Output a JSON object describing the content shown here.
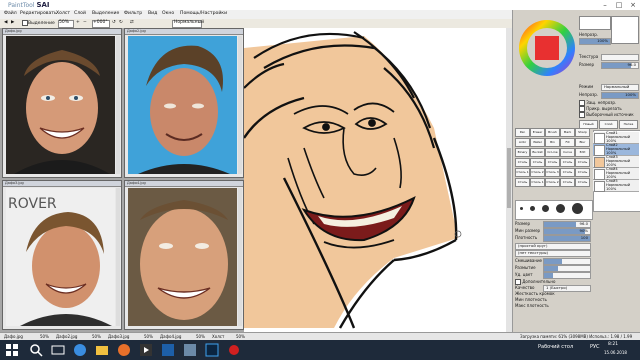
{
  "app": {
    "title_prefix": "PaintTool",
    "title_brand": "SAI"
  },
  "menu": [
    "Файл",
    "Редактировать",
    "Холст",
    "Слой",
    "Выделение",
    "Фильтр",
    "Вид",
    "Окно",
    "Помощь/Настройки"
  ],
  "toolbar": {
    "checkbox_label": "Выделение",
    "zoom": "50%",
    "angle": "+000°",
    "mode_label": "Нормальный"
  },
  "documents": [
    {
      "name": "Дафо.jpg"
    },
    {
      "name": "Дафо2.jpg"
    },
    {
      "name": "Дафо3.jpg"
    },
    {
      "name": "Дафо4.jpg"
    }
  ],
  "right_panel": {
    "color_values": [
      "Непрозр.",
      "100%"
    ],
    "brush_rows": [
      {
        "label": "Текстура",
        "value": ""
      },
      {
        "label": "Размер",
        "value": "96.0"
      }
    ],
    "mode_label": "Режим",
    "mode_value": "Нормальный",
    "opacity_label": "Непрозр.",
    "opacity_value": "100%",
    "checkbox_rows": [
      "Защ. непрозр.",
      "Прикр. вырезать",
      "Выборочный источник"
    ],
    "layer_buttons": [
      "Новый",
      "Слой",
      "Папка"
    ],
    "tools": [
      [
        "Pen",
        "Eraser",
        "Brush",
        "Mark",
        "Sharp"
      ],
      [
        "Airbr",
        "Water",
        "Bin",
        "Fill",
        "Blur"
      ],
      [
        "Binary",
        "Bucket",
        "Cr.Line",
        "Curve",
        "Edit"
      ],
      [
        "Стиль",
        "Стиль",
        "Стиль",
        "Стиль",
        "Стиль"
      ],
      [
        "Стиль 1",
        "Стиль 2",
        "Стиль 3",
        "Стиль",
        "Стиль"
      ],
      [
        "Стиль",
        "Стиль 1",
        "Стиль 2",
        "Стиль",
        "Стиль"
      ]
    ],
    "brush_settings": [
      {
        "label": "Размер",
        "value": "96.0"
      },
      {
        "label": "Мин размер",
        "value": "90%"
      },
      {
        "label": "Плотность",
        "value": "100"
      },
      {
        "label": "(простой круг)",
        "value": ""
      },
      {
        "label": "(нет текстуры)",
        "value": ""
      },
      {
        "label": "Смешивание",
        "value": ""
      },
      {
        "label": "Размытие",
        "value": ""
      },
      {
        "label": "Уд. цвет",
        "value": ""
      }
    ],
    "brush_checkboxes": [
      "Дополнительно",
      "Качество",
      "Жесткость кромок",
      "Мин плотность",
      "Макс плотность",
      "Чувствительность",
      "Давление"
    ],
    "quality_value": "1 (Быстро)",
    "layers": [
      {
        "name": "Слой1",
        "mode": "Нормальный",
        "opacity": "100%"
      },
      {
        "name": "Слой2",
        "mode": "Нормальный",
        "opacity": "100%"
      },
      {
        "name": "Слой3",
        "mode": "Нормальный",
        "opacity": "100%"
      },
      {
        "name": "Слой4",
        "mode": "Нормальный",
        "opacity": "100%"
      },
      {
        "name": "Слой5",
        "mode": "Нормальный",
        "opacity": "100%"
      }
    ],
    "blend_mode": "Нормальный"
  },
  "status": {
    "items": [
      "Дафо.jpg",
      "50%",
      "Дафо2.jpg",
      "50%",
      "Дафо3.jpg",
      "50%",
      "Дафо4.jpg",
      "50%",
      "Холст",
      "50%"
    ],
    "memory": "Загрузка памяти: 61% (3098MB)  Использ.: 1.98 / 1.99"
  },
  "taskbar": {
    "time": "8:21",
    "date": "15.06.2018",
    "desktop": "Рабочий стол",
    "lang": "РУС"
  },
  "colors": {
    "skin": "#f1c79b",
    "line": "#111111",
    "mouth": "#7b1b1b",
    "accent": "#e83030"
  }
}
